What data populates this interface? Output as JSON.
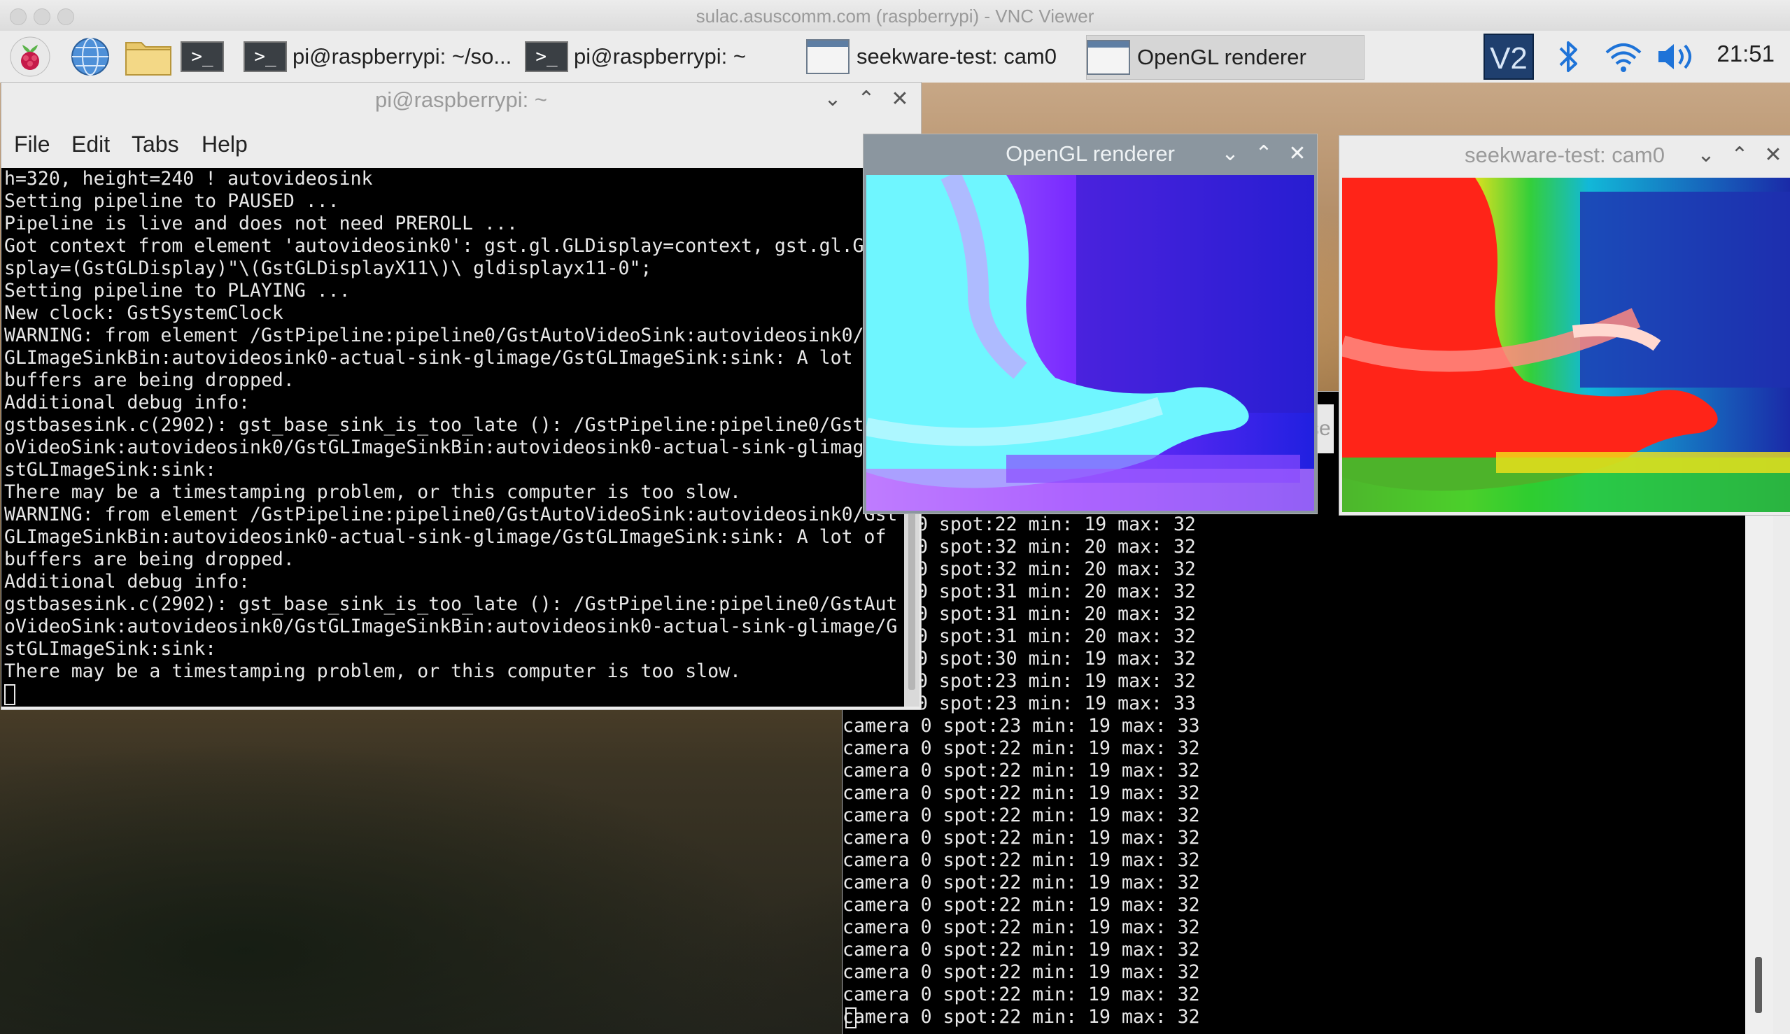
{
  "mac": {
    "title": "sulac.asuscomm.com (raspberrypi) - VNC Viewer"
  },
  "panel": {
    "tasks": [
      {
        "label": "pi@raspberrypi: ~/so..."
      },
      {
        "label": "pi@raspberrypi: ~"
      },
      {
        "label": "seekware-test: cam0"
      },
      {
        "label": "OpenGL renderer"
      }
    ],
    "clock": "21:51",
    "icons": [
      "raspberry-menu-icon",
      "browser-globe-icon",
      "file-manager-icon",
      "terminal-icon",
      "vnc-icon",
      "bluetooth-icon",
      "wifi-icon",
      "volume-icon"
    ]
  },
  "main_terminal": {
    "title": "pi@raspberrypi: ~",
    "menu": [
      "File",
      "Edit",
      "Tabs",
      "Help"
    ],
    "lines": [
      "h=320, height=240 ! autovideosink",
      "Setting pipeline to PAUSED ...",
      "Pipeline is live and does not need PREROLL ...",
      "Got context from element 'autovideosink0': gst.gl.GLDisplay=context, gst.gl.G",
      "splay=(GstGLDisplay)\"\\(GstGLDisplayX11\\)\\ gldisplayx11-0\";",
      "Setting pipeline to PLAYING ...",
      "New clock: GstSystemClock",
      "WARNING: from element /GstPipeline:pipeline0/GstAutoVideoSink:autovideosink0/",
      "GLImageSinkBin:autovideosink0-actual-sink-glimage/GstGLImageSink:sink: A lot",
      "buffers are being dropped.",
      "Additional debug info:",
      "gstbasesink.c(2902): gst_base_sink_is_too_late (): /GstPipeline:pipeline0/Gst",
      "oVideoSink:autovideosink0/GstGLImageSinkBin:autovideosink0-actual-sink-glimag",
      "stGLImageSink:sink:",
      "There may be a timestamping problem, or this computer is too slow.",
      "WARNING: from element /GstPipeline:pipeline0/GstAutoVideoSink:autovideosink0/Gst",
      "GLImageSinkBin:autovideosink0-actual-sink-glimage/GstGLImageSink:sink: A lot of",
      "buffers are being dropped.",
      "Additional debug info:",
      "gstbasesink.c(2902): gst_base_sink_is_too_late (): /GstPipeline:pipeline0/GstAut",
      "oVideoSink:autovideosink0/GstGLImageSinkBin:autovideosink0-actual-sink-glimage/G",
      "stGLImageSink:sink:",
      "There may be a timestamping problem, or this computer is too slow."
    ]
  },
  "back_terminal": {
    "partial_title": "se",
    "lines_partial": [
      "0 spot:22 min: 19 max: 32",
      "0 spot:32 min: 20 max: 32",
      "0 spot:32 min: 20 max: 32",
      "0 spot:31 min: 20 max: 32",
      "0 spot:31 min: 20 max: 32",
      "0 spot:31 min: 20 max: 32",
      "0 spot:30 min: 19 max: 32",
      "0 spot:23 min: 19 max: 32",
      "0 spot:23 min: 19 max: 33"
    ],
    "lines_full": [
      "camera 0 spot:23 min: 19 max: 33",
      "camera 0 spot:22 min: 19 max: 32",
      "camera 0 spot:22 min: 19 max: 32",
      "camera 0 spot:22 min: 19 max: 32",
      "camera 0 spot:22 min: 19 max: 32",
      "camera 0 spot:22 min: 19 max: 32",
      "camera 0 spot:22 min: 19 max: 32",
      "camera 0 spot:22 min: 19 max: 32",
      "camera 0 spot:22 min: 19 max: 32",
      "camera 0 spot:22 min: 19 max: 32",
      "camera 0 spot:22 min: 19 max: 32",
      "camera 0 spot:22 min: 19 max: 32",
      "camera 0 spot:22 min: 19 max: 32",
      "camera 0 spot:22 min: 19 max: 32"
    ]
  },
  "opengl_window": {
    "title": "OpenGL renderer",
    "palette": [
      "#1f1fd8",
      "#7a1cff",
      "#b86cff",
      "#49f0ff",
      "#ffffff"
    ]
  },
  "seekware_window": {
    "title": "seekware-test: cam0",
    "palette": [
      "#1a2aa8",
      "#16c7d8",
      "#2ecc2e",
      "#f2e21a",
      "#ff2a1a",
      "#ffffff"
    ]
  }
}
